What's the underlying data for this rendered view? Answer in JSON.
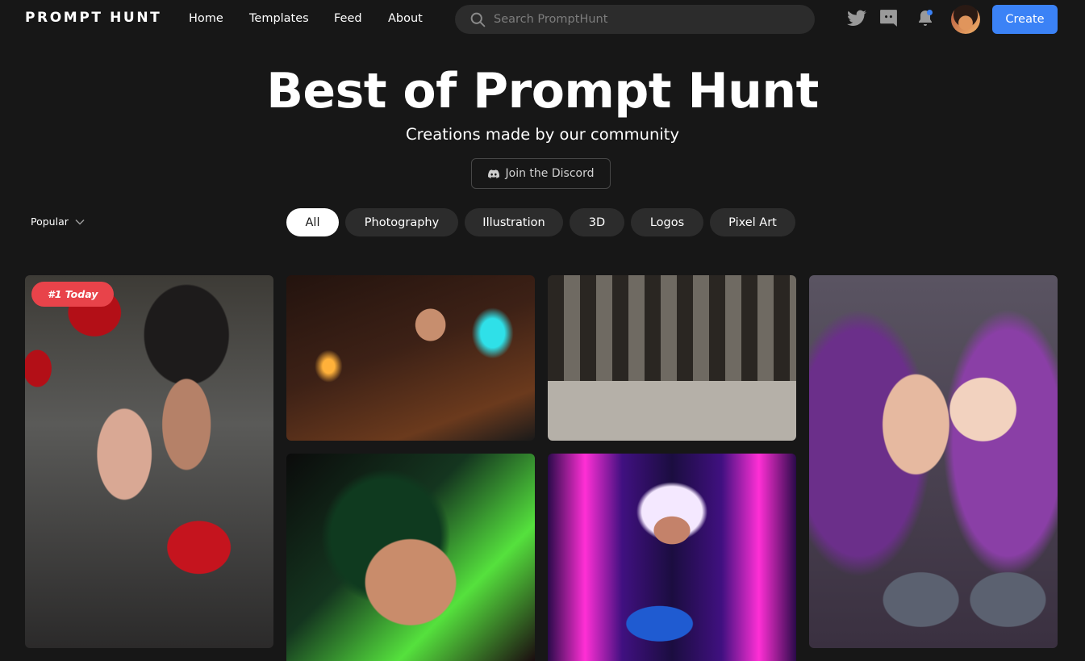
{
  "header": {
    "logo": "PROMPT HUNT",
    "nav": [
      {
        "label": "Home"
      },
      {
        "label": "Templates"
      },
      {
        "label": "Feed"
      },
      {
        "label": "About"
      }
    ],
    "search_placeholder": "Search PromptHunt",
    "icons": [
      "twitter-icon",
      "discord-icon",
      "bell-icon"
    ],
    "notification_dot_color": "#3b82f6",
    "create_label": "Create"
  },
  "hero": {
    "title": "Best of Prompt Hunt",
    "subtitle": "Creations made by our community",
    "discord_button": "Join the Discord"
  },
  "filters": {
    "sort": "Popular",
    "categories": [
      {
        "label": "All",
        "active": true
      },
      {
        "label": "Photography"
      },
      {
        "label": "Illustration"
      },
      {
        "label": "3D"
      },
      {
        "label": "Logos"
      },
      {
        "label": "Pixel Art"
      }
    ]
  },
  "gallery": {
    "badge": "#1 Today",
    "items": [
      {
        "image": "couple-with-roses"
      },
      {
        "image": "woman-at-glowing-laptop"
      },
      {
        "image": "industrial-factory-interior"
      },
      {
        "image": "purple-haired-fantasy-woman"
      },
      {
        "image": "neon-green-makeup-portrait"
      },
      {
        "image": "neon-cyberpunk-girl"
      }
    ]
  },
  "colors": {
    "background": "#171717",
    "accent": "#3b82f6",
    "chip": "#2c2c2c",
    "badge": "#e8434a"
  }
}
